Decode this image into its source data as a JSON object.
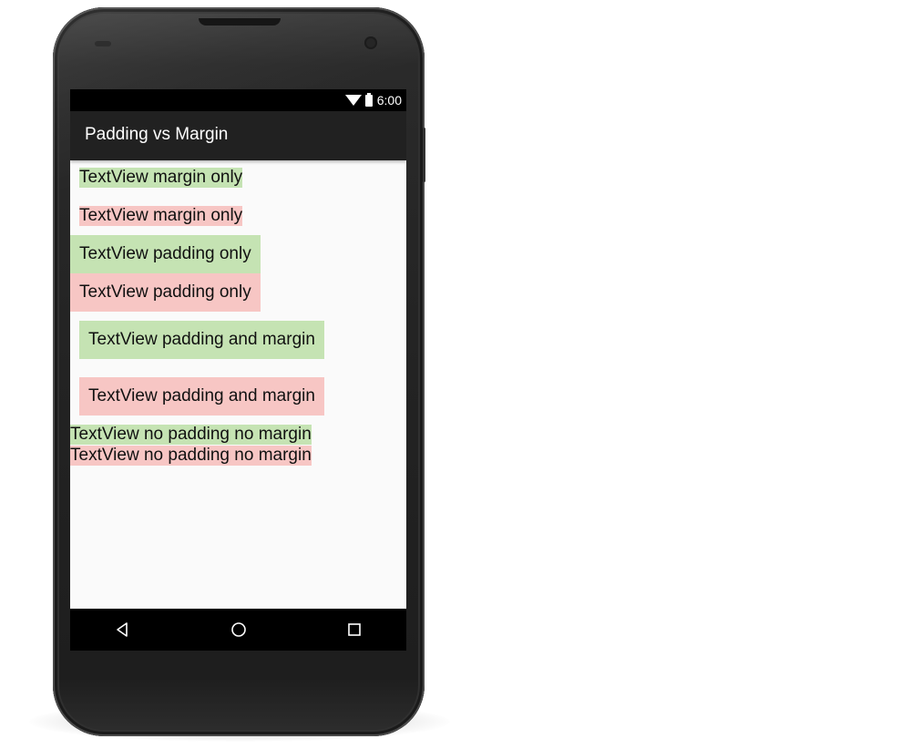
{
  "status_bar": {
    "time": "6:00",
    "icons": [
      "wifi-icon",
      "battery-icon"
    ]
  },
  "app_bar": {
    "title": "Padding vs Margin"
  },
  "textviews": [
    {
      "text": "TextView margin only",
      "color": "#c5e3b3"
    },
    {
      "text": "TextView margin only",
      "color": "#f7c6c4"
    },
    {
      "text": "TextView padding only",
      "color": "#c5e3b3"
    },
    {
      "text": "TextView padding only",
      "color": "#f7c6c4"
    },
    {
      "text": "TextView padding and margin",
      "color": "#c5e3b3"
    },
    {
      "text": "TextView padding and margin",
      "color": "#f7c6c4"
    },
    {
      "text": "TextView no padding no margin",
      "color": "#c5e3b3"
    },
    {
      "text": "TextView no padding no margin",
      "color": "#f7c6c4"
    }
  ],
  "nav_bar": {
    "icons": [
      "back-icon",
      "home-icon",
      "recents-icon"
    ]
  }
}
